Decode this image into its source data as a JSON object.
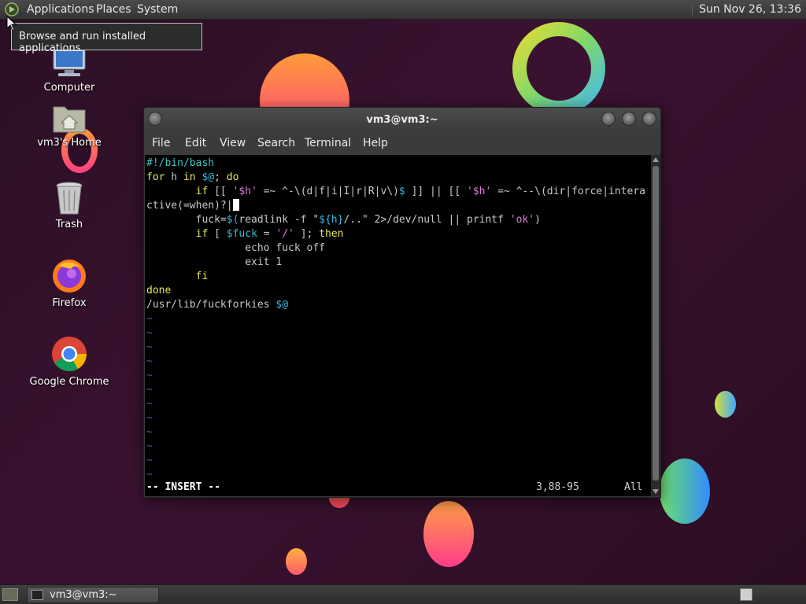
{
  "top_panel": {
    "menus": [
      "Applications",
      "Places",
      "System"
    ],
    "clock": "Sun Nov 26, 13:36",
    "tooltip": "Browse and run installed applications"
  },
  "desktop_icons": [
    {
      "label": "Computer",
      "icon": "computer-icon"
    },
    {
      "label": "vm3's Home",
      "icon": "home-folder-icon"
    },
    {
      "label": "Trash",
      "icon": "trash-icon"
    },
    {
      "label": "Firefox",
      "icon": "firefox-icon"
    },
    {
      "label": "Google Chrome",
      "icon": "chrome-icon"
    }
  ],
  "window": {
    "title": "vm3@vm3:~",
    "menu": [
      "File",
      "Edit",
      "View",
      "Search",
      "Terminal",
      "Help"
    ]
  },
  "terminal": {
    "lines": [
      "#!/bin/bash",
      "for h in $@; do",
      "        if [[ '$h' =~ ^-\\(d|f|i|I|r|R|v\\)$ ]] || [[ '$h' =~ ^--\\(dir|force|intera",
      "ctive(=when)?|",
      "        fuck=$(readlink -f \"${h}/..\" 2>/dev/null || printf 'ok')",
      "        if [ $fuck = '/' ]; then",
      "                echo fuck off",
      "                exit 1",
      "        fi",
      "done",
      "/usr/lib/fuckforkies $@"
    ],
    "empty_line_marker": "~",
    "empty_line_count": 12,
    "mode": "-- INSERT --",
    "cursor_position": "3,88-95",
    "scroll_position": "All"
  },
  "taskbar": {
    "task_label": "vm3@vm3:~"
  },
  "colors": {
    "comment_cyan": "#3fc6c8",
    "keyword_yellow": "#e5e55a",
    "string_pink": "#e07ad8",
    "variable_cyan": "#39b8e0",
    "tilde_blue": "#4b5aa8"
  }
}
